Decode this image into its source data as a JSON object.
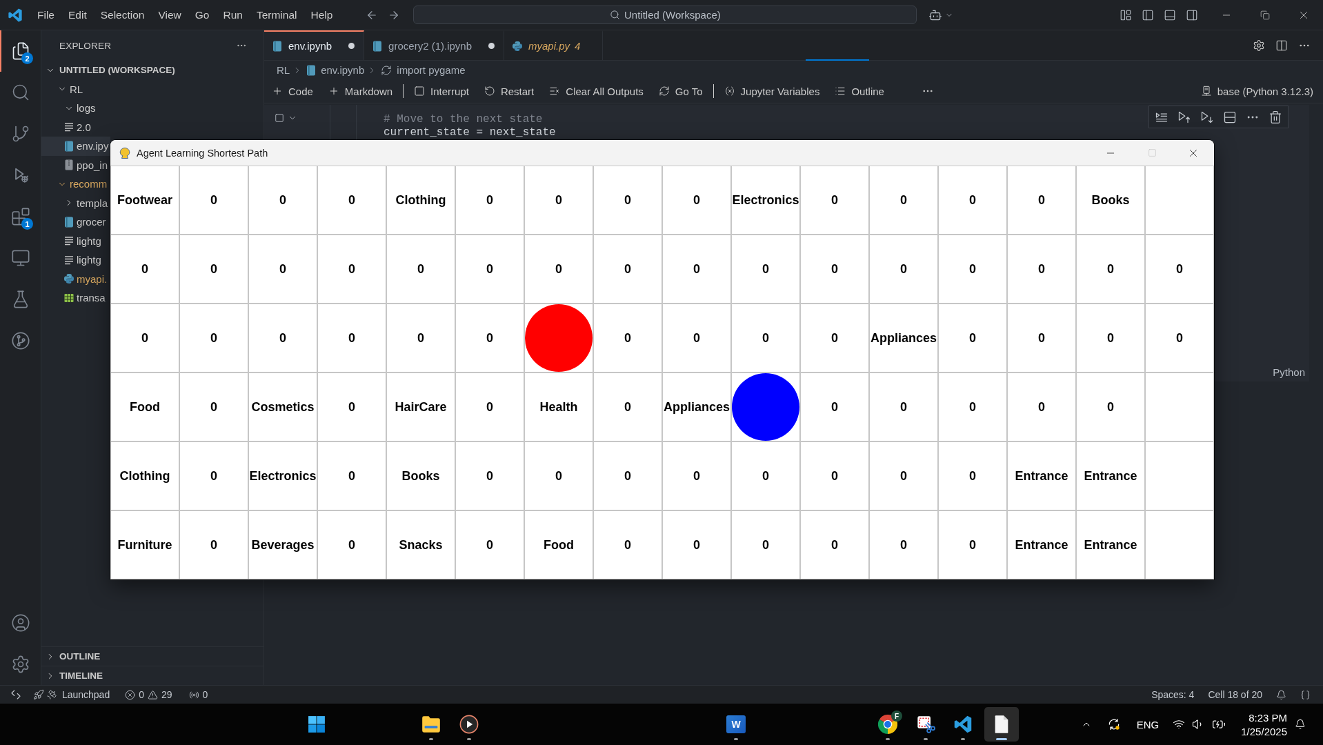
{
  "titlebar": {
    "menu": [
      "File",
      "Edit",
      "Selection",
      "View",
      "Go",
      "Run",
      "Terminal",
      "Help"
    ],
    "command_center": "Untitled (Workspace)"
  },
  "activity_bar": {
    "items": [
      {
        "selected": true,
        "badge": "2"
      },
      {
        "selected": false
      },
      {
        "selected": false
      },
      {
        "selected": false
      },
      {
        "selected": false,
        "badge": "1"
      },
      {
        "selected": false
      },
      {
        "selected": false
      },
      {
        "selected": false
      }
    ]
  },
  "sidebar": {
    "title": "EXPLORER",
    "workspace": {
      "label": "UNTITLED (WORKSPACE)",
      "expanded": true
    },
    "tree": [
      {
        "kind": "folder",
        "label": "RL",
        "expanded": true,
        "selected": false,
        "modified": false,
        "children": [
          {
            "kind": "folder",
            "label": "logs",
            "expanded": true,
            "selected": false,
            "modified": false
          },
          {
            "kind": "text",
            "label": "2.0",
            "selected": false,
            "modified": false
          },
          {
            "kind": "notebook",
            "label": "env.ipy",
            "selected": true,
            "modified": false
          },
          {
            "kind": "archive",
            "label": "ppo_in",
            "selected": false,
            "modified": false
          }
        ]
      },
      {
        "kind": "folder",
        "label": "recomm",
        "expanded": true,
        "selected": false,
        "modified": true,
        "children": [
          {
            "kind": "folder",
            "label": "templa",
            "expanded": false,
            "selected": false,
            "modified": false
          },
          {
            "kind": "notebook",
            "label": "grocer",
            "selected": false,
            "modified": false
          },
          {
            "kind": "text",
            "label": "lightg",
            "selected": false,
            "modified": false
          },
          {
            "kind": "text",
            "label": "lightg",
            "selected": false,
            "modified": false
          },
          {
            "kind": "python",
            "label": "myapi.",
            "selected": false,
            "modified": true
          },
          {
            "kind": "spreadsheet",
            "label": "transa",
            "selected": false,
            "modified": false
          }
        ]
      }
    ],
    "sections": [
      {
        "label": "OUTLINE",
        "expanded": false
      },
      {
        "label": "TIMELINE",
        "expanded": false
      }
    ]
  },
  "tabs": [
    {
      "kind": "notebook",
      "label": "env.ipynb",
      "selected": true,
      "dirty": true,
      "preview": false
    },
    {
      "kind": "notebook",
      "label": "grocery2 (1).ipynb",
      "selected": false,
      "dirty": true,
      "preview": false
    },
    {
      "kind": "python",
      "label": "myapi.py",
      "selected": false,
      "dirty": false,
      "preview": true,
      "problems": "4"
    }
  ],
  "editor": {
    "busy": true,
    "breadcrumbs": [
      {
        "kind": "folder",
        "label": "RL"
      },
      {
        "kind": "notebook",
        "label": "env.ipynb"
      },
      {
        "kind": "symbol",
        "label": "import pygame"
      }
    ],
    "toolbar": [
      "Code",
      "Markdown",
      "Interrupt",
      "Restart",
      "Clear All Outputs",
      "Go To",
      "Jupyter Variables",
      "Outline"
    ],
    "kernel": "base (Python 3.12.3)",
    "cell": {
      "lines": [
        {
          "kind": "comment",
          "text": "# Move to the next state"
        },
        {
          "kind": "code",
          "text": "current_state = next_state"
        }
      ],
      "language": "Python"
    }
  },
  "game_window": {
    "title": "Agent Learning Shortest Path",
    "maximize_disabled": true,
    "rows": [
      [
        {
          "kind": "text",
          "text": "Footwear"
        },
        {
          "kind": "text",
          "text": "0"
        },
        {
          "kind": "text",
          "text": "0"
        },
        {
          "kind": "text",
          "text": "0"
        },
        {
          "kind": "text",
          "text": "Clothing"
        },
        {
          "kind": "text",
          "text": "0"
        },
        {
          "kind": "text",
          "text": "0"
        },
        {
          "kind": "text",
          "text": "0"
        },
        {
          "kind": "text",
          "text": "0"
        },
        {
          "kind": "text",
          "text": "Electronics"
        },
        {
          "kind": "text",
          "text": "0"
        },
        {
          "kind": "text",
          "text": "0"
        },
        {
          "kind": "text",
          "text": "0"
        },
        {
          "kind": "text",
          "text": "0"
        },
        {
          "kind": "text",
          "text": "Books"
        },
        {
          "kind": "blank"
        }
      ],
      [
        {
          "kind": "text",
          "text": "0"
        },
        {
          "kind": "text",
          "text": "0"
        },
        {
          "kind": "text",
          "text": "0"
        },
        {
          "kind": "text",
          "text": "0"
        },
        {
          "kind": "text",
          "text": "0"
        },
        {
          "kind": "text",
          "text": "0"
        },
        {
          "kind": "text",
          "text": "0"
        },
        {
          "kind": "text",
          "text": "0"
        },
        {
          "kind": "text",
          "text": "0"
        },
        {
          "kind": "text",
          "text": "0"
        },
        {
          "kind": "text",
          "text": "0"
        },
        {
          "kind": "text",
          "text": "0"
        },
        {
          "kind": "text",
          "text": "0"
        },
        {
          "kind": "text",
          "text": "0"
        },
        {
          "kind": "text",
          "text": "0"
        },
        {
          "kind": "text",
          "text": "0"
        }
      ],
      [
        {
          "kind": "text",
          "text": "0"
        },
        {
          "kind": "text",
          "text": "0"
        },
        {
          "kind": "text",
          "text": "0"
        },
        {
          "kind": "text",
          "text": "0"
        },
        {
          "kind": "text",
          "text": "0"
        },
        {
          "kind": "text",
          "text": "0"
        },
        {
          "kind": "token",
          "color": "#ff0000"
        },
        {
          "kind": "text",
          "text": "0"
        },
        {
          "kind": "text",
          "text": "0"
        },
        {
          "kind": "text",
          "text": "0"
        },
        {
          "kind": "text",
          "text": "0"
        },
        {
          "kind": "text",
          "text": "Appliances"
        },
        {
          "kind": "text",
          "text": "0"
        },
        {
          "kind": "text",
          "text": "0"
        },
        {
          "kind": "text",
          "text": "0"
        },
        {
          "kind": "text",
          "text": "0"
        }
      ],
      [
        {
          "kind": "text",
          "text": "Food"
        },
        {
          "kind": "text",
          "text": "0"
        },
        {
          "kind": "text",
          "text": "Cosmetics"
        },
        {
          "kind": "text",
          "text": "0"
        },
        {
          "kind": "text",
          "text": "HairCare"
        },
        {
          "kind": "text",
          "text": "0"
        },
        {
          "kind": "text",
          "text": "Health"
        },
        {
          "kind": "text",
          "text": "0"
        },
        {
          "kind": "text",
          "text": "Appliances"
        },
        {
          "kind": "token",
          "color": "#0000ff"
        },
        {
          "kind": "text",
          "text": "0"
        },
        {
          "kind": "text",
          "text": "0"
        },
        {
          "kind": "text",
          "text": "0"
        },
        {
          "kind": "text",
          "text": "0"
        },
        {
          "kind": "text",
          "text": "0"
        },
        {
          "kind": "blank"
        }
      ],
      [
        {
          "kind": "text",
          "text": "Clothing"
        },
        {
          "kind": "text",
          "text": "0"
        },
        {
          "kind": "text",
          "text": "Electronics"
        },
        {
          "kind": "text",
          "text": "0"
        },
        {
          "kind": "text",
          "text": "Books"
        },
        {
          "kind": "text",
          "text": "0"
        },
        {
          "kind": "text",
          "text": "0"
        },
        {
          "kind": "text",
          "text": "0"
        },
        {
          "kind": "text",
          "text": "0"
        },
        {
          "kind": "text",
          "text": "0"
        },
        {
          "kind": "text",
          "text": "0"
        },
        {
          "kind": "text",
          "text": "0"
        },
        {
          "kind": "text",
          "text": "0"
        },
        {
          "kind": "text",
          "text": "Entrance"
        },
        {
          "kind": "text",
          "text": "Entrance"
        },
        {
          "kind": "blank"
        }
      ],
      [
        {
          "kind": "text",
          "text": "Furniture"
        },
        {
          "kind": "text",
          "text": "0"
        },
        {
          "kind": "text",
          "text": "Beverages"
        },
        {
          "kind": "text",
          "text": "0"
        },
        {
          "kind": "text",
          "text": "Snacks"
        },
        {
          "kind": "text",
          "text": "0"
        },
        {
          "kind": "text",
          "text": "Food"
        },
        {
          "kind": "text",
          "text": "0"
        },
        {
          "kind": "text",
          "text": "0"
        },
        {
          "kind": "text",
          "text": "0"
        },
        {
          "kind": "text",
          "text": "0"
        },
        {
          "kind": "text",
          "text": "0"
        },
        {
          "kind": "text",
          "text": "0"
        },
        {
          "kind": "text",
          "text": "Entrance"
        },
        {
          "kind": "text",
          "text": "Entrance"
        },
        {
          "kind": "blank"
        }
      ]
    ]
  },
  "status_bar": {
    "launchpad": "Launchpad",
    "errors": "0",
    "warnings": "29",
    "ports": "0",
    "indentation": "Spaces: 4",
    "cell_position": "Cell 18 of 20"
  },
  "taskbar": {
    "apps": [
      {
        "selected": false
      },
      {
        "selected": false
      },
      {
        "selected": false,
        "glyph": "W"
      },
      {
        "selected": false,
        "badge": "F"
      },
      {
        "selected": false
      },
      {
        "selected": false
      },
      {
        "selected": true
      }
    ],
    "tray": {
      "language": "ENG",
      "time": "8:23 PM",
      "date": "1/25/2025"
    }
  }
}
